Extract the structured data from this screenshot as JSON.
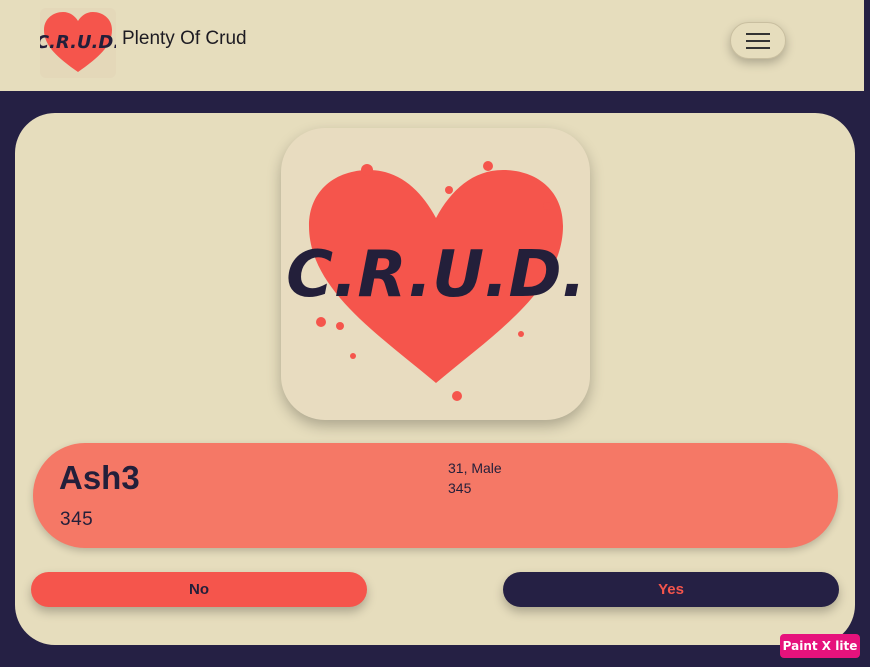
{
  "navbar": {
    "brand_name": "Plenty Of Crud",
    "logo_text": "C.R.U.D."
  },
  "profile": {
    "image_text": "C.R.U.D.",
    "name": "Ash3",
    "id": "345",
    "age_gender": "31, Male",
    "secondary": "345"
  },
  "actions": {
    "no_label": "No",
    "yes_label": "Yes"
  },
  "overlay": {
    "badge": "Paint X lite"
  },
  "colors": {
    "background": "#252044",
    "cream": "#e6ddbd",
    "coral": "#f57866",
    "red": "#f5554c",
    "navy": "#252044"
  }
}
